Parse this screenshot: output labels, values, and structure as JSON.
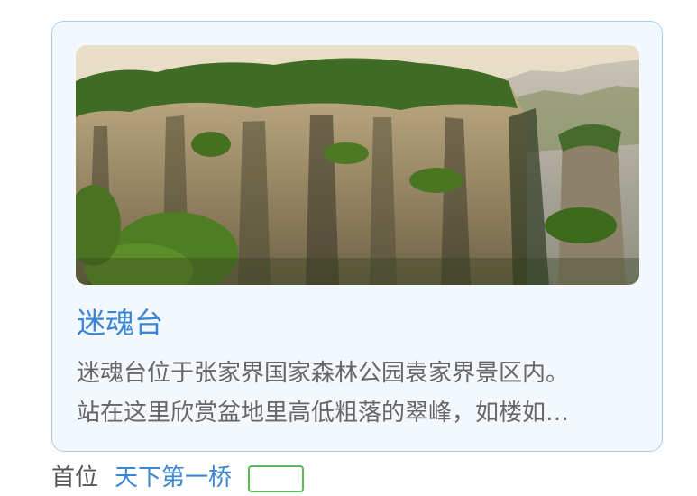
{
  "card": {
    "image_alt": "张家界 迷魂台 山峰",
    "title": "迷魂台",
    "description_lines": [
      "迷魂台位于张家界国家森林公园袁家界景区内。",
      "站在这里欣赏盆地里高低粗落的翠峰，如楼如…"
    ]
  },
  "next_item": {
    "prefix": "首位",
    "link_text": "天下第一桥"
  },
  "colors": {
    "accent": "#3a86d6",
    "card_border": "#a9cdee",
    "card_bg": "#f3f8fd",
    "body_text": "#666666",
    "badge_border": "#5cb85c"
  }
}
